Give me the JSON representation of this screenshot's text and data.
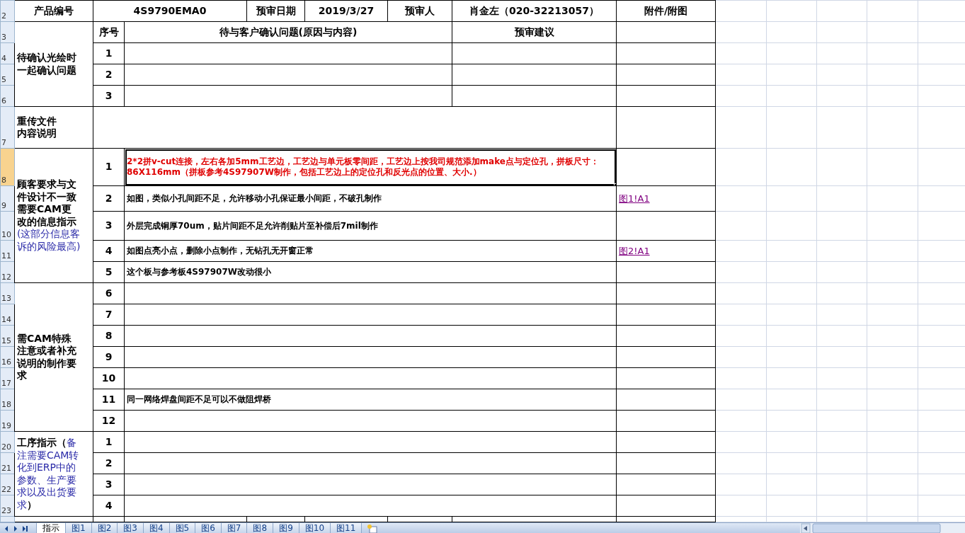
{
  "header": {
    "product_label": "产品编号",
    "product_no": "4S9790EMA0",
    "date_label": "预审日期",
    "date": "2019/3/27",
    "reviewer_label": "预审人",
    "reviewer": "肖金左（020-32213057）",
    "attach_label": "附件/附图"
  },
  "columns": {
    "no": "序号",
    "question": "待与客户确认问题(原因与内容)",
    "advice": "预审建议"
  },
  "sections": [
    {
      "kind": "confirm",
      "label": [
        {
          "kind": "plain",
          "text": "待确认光绘时一起确认问题"
        }
      ],
      "rows": [
        {
          "no": "1"
        },
        {
          "no": "2"
        },
        {
          "no": "3"
        }
      ]
    },
    {
      "kind": "text_only",
      "label": [
        {
          "kind": "plain",
          "text": "重传文件内容说明"
        }
      ]
    },
    {
      "kind": "items",
      "label": [
        {
          "kind": "plain",
          "text": "顾客要求与文件设计不一致需要CAM更改的信息指示"
        },
        {
          "kind": "note",
          "text": "(这部分信息客诉的风险最高)"
        }
      ],
      "rows": [
        {
          "no": "1",
          "text": "2*2拼v-cut连接，左右各加5mm工艺边，工艺边与单元板零间距，工艺边上按我司规范添加make点与定位孔，拼板尺寸：86X116mm（拼板参考4S97907W制作，包括工艺边上的定位孔和反光点的位置、大小.）",
          "emphasis": true,
          "selected": true
        },
        {
          "no": "2",
          "text": "如图，类似小孔间距不足，允许移动小孔保证最小间距，不破孔制作",
          "emphasis": false,
          "selected": false,
          "attachment": "图1!A1"
        },
        {
          "no": "3",
          "text": "外层完成铜厚70um，贴片间距不足允许削贴片至补偿后7mil制作",
          "emphasis": false,
          "selected": false
        },
        {
          "no": "4",
          "text": "如图点亮小点，删除小点制作，无钻孔无开窗正常",
          "emphasis": false,
          "selected": false,
          "attachment": "图2!A1"
        },
        {
          "no": "5",
          "text": "这个板与参考板4S97907W改动很小",
          "emphasis": false,
          "selected": false
        }
      ]
    },
    {
      "kind": "items",
      "label": [
        {
          "kind": "plain",
          "text": "需CAM特殊注意或者补充说明的制作要求"
        }
      ],
      "rows": [
        {
          "no": "6",
          "selected": false
        },
        {
          "no": "7",
          "selected": false
        },
        {
          "no": "8",
          "selected": false
        },
        {
          "no": "9",
          "selected": false
        },
        {
          "no": "10",
          "selected": false
        },
        {
          "no": "11",
          "text": "同一网络焊盘间距不足可以不做阻焊桥",
          "emphasis": false,
          "selected": false
        },
        {
          "no": "12",
          "selected": false
        }
      ]
    },
    {
      "kind": "items",
      "label": [
        {
          "kind": "plain",
          "text": "工序指示（"
        },
        {
          "kind": "note",
          "text": "备注需要CAM转化到ERP中的参数、生产要求以及出货要求"
        },
        {
          "kind": "plain",
          "text": "）"
        }
      ],
      "rows": [
        {
          "no": "1",
          "selected": false
        },
        {
          "no": "2",
          "selected": false
        },
        {
          "no": "3",
          "selected": false
        },
        {
          "no": "4",
          "selected": false
        }
      ]
    }
  ],
  "row_headers": [
    {
      "label": "2",
      "selected": false
    },
    {
      "label": "3",
      "selected": false
    },
    {
      "label": "4",
      "selected": false
    },
    {
      "label": "5",
      "selected": false
    },
    {
      "label": "6",
      "selected": false
    },
    {
      "label": "7",
      "selected": false
    },
    {
      "label": "8",
      "selected": true
    },
    {
      "label": "9",
      "selected": false
    },
    {
      "label": "10",
      "selected": false
    },
    {
      "label": "11",
      "selected": false
    },
    {
      "label": "12",
      "selected": false
    },
    {
      "label": "13",
      "selected": false
    },
    {
      "label": "14",
      "selected": false
    },
    {
      "label": "15",
      "selected": false
    },
    {
      "label": "16",
      "selected": false
    },
    {
      "label": "17",
      "selected": false
    },
    {
      "label": "18",
      "selected": false
    },
    {
      "label": "19",
      "selected": false
    },
    {
      "label": "20",
      "selected": false
    },
    {
      "label": "21",
      "selected": false
    },
    {
      "label": "22",
      "selected": false
    },
    {
      "label": "23",
      "selected": false
    }
  ],
  "sheet_tabs": [
    {
      "label": "指示",
      "selected": true
    },
    {
      "label": "图1",
      "selected": false
    },
    {
      "label": "图2",
      "selected": false
    },
    {
      "label": "图3",
      "selected": false
    },
    {
      "label": "图4",
      "selected": false
    },
    {
      "label": "图5",
      "selected": false
    },
    {
      "label": "图6",
      "selected": false
    },
    {
      "label": "图7",
      "selected": false
    },
    {
      "label": "图8",
      "selected": false
    },
    {
      "label": "图9",
      "selected": false
    },
    {
      "label": "图10",
      "selected": false
    },
    {
      "label": "图11",
      "selected": false
    }
  ]
}
